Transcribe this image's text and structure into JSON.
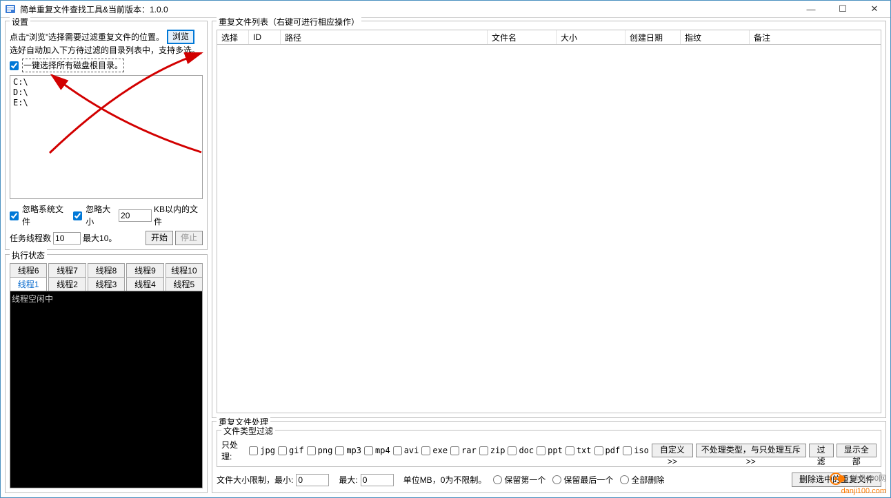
{
  "window": {
    "title": "简单重复文件查找工具&当前版本：1.0.0"
  },
  "settings": {
    "group_title": "设置",
    "hint_line1_a": "点击“浏览”选择需要过滤重复文件的位置。",
    "browse_btn": "浏览",
    "hint_line2": "选好自动加入下方待过滤的目录列表中，支持多选。",
    "select_all_disks_label": "一键选择所有磁盘根目录。",
    "paths": "C:\\\nD:\\\nE:\\",
    "ignore_sys_label": "忽略系统文件",
    "ignore_size_label": "忽略大小",
    "ignore_size_value": "20",
    "ignore_size_suffix": "KB以内的文件",
    "threads_label": "任务线程数",
    "threads_value": "10",
    "threads_suffix": "最大10。",
    "start_btn": "开始",
    "stop_btn": "停止"
  },
  "exec": {
    "group_title": "执行状态",
    "tabs_row1": [
      "线程6",
      "线程7",
      "线程8",
      "线程9",
      "线程10"
    ],
    "tabs_row2": [
      "线程1",
      "线程2",
      "线程3",
      "线程4",
      "线程5"
    ],
    "console_text": "线程空闲中"
  },
  "list": {
    "group_title": "重复文件列表（右键可进行相应操作）",
    "columns": {
      "select": "选择",
      "id": "ID",
      "path": "路径",
      "name": "文件名",
      "size": "大小",
      "date": "创建日期",
      "hash": "指纹",
      "note": "备注"
    }
  },
  "proc": {
    "outer_title": "重复文件处理",
    "filter_title": "文件类型过滤",
    "only_label": "只处理:",
    "types": [
      "jpg",
      "gif",
      "png",
      "mp3",
      "mp4",
      "avi",
      "exe",
      "rar",
      "zip",
      "doc",
      "ppt",
      "txt",
      "pdf",
      "iso"
    ],
    "custom_btn": "自定义>>",
    "exclude_btn": "不处理类型，与只处理互斥>>",
    "filter_btn": "过滤",
    "show_all_btn": "显示全部",
    "size_limit_label_a": "文件大小限制，最小:",
    "size_min": "0",
    "size_limit_label_b": "最大:",
    "size_max": "0",
    "size_unit": "单位MB，0为不限制。",
    "keep_first": "保留第一个",
    "keep_last": "保留最后一个",
    "delete_all": "全部删除",
    "delete_btn": "删除选中的重复文件"
  },
  "watermark": {
    "line1": "单机100网",
    "line2": "danji100.com"
  }
}
